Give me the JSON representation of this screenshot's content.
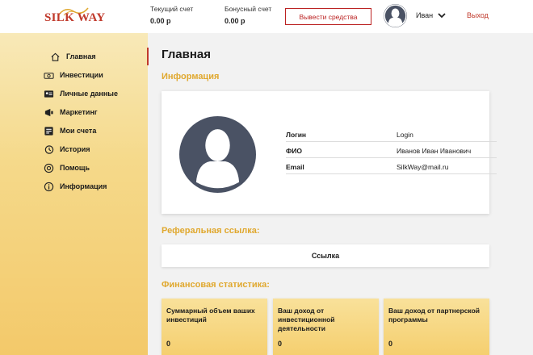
{
  "header": {
    "logo_text": "SILK WAY",
    "balance_current_label": "Текущий счет",
    "balance_current_value": "0.00 р",
    "balance_bonus_label": "Бонусный счет",
    "balance_bonus_value": "0.00 р",
    "withdraw_label": "Вывести средства",
    "user_name": "Иван",
    "logout_label": "Выход"
  },
  "sidebar": {
    "items": [
      {
        "label": "Главная",
        "icon": "home-icon",
        "active": true
      },
      {
        "label": "Инвестиции",
        "icon": "money-icon"
      },
      {
        "label": "Личные данные",
        "icon": "id-card-icon"
      },
      {
        "label": "Маркетинг",
        "icon": "marketing-icon"
      },
      {
        "label": "Мои счета",
        "icon": "accounts-icon"
      },
      {
        "label": "История",
        "icon": "history-icon"
      },
      {
        "label": "Помощь",
        "icon": "help-icon"
      },
      {
        "label": "Информация",
        "icon": "info-icon"
      }
    ]
  },
  "main": {
    "title": "Главная",
    "info_section_title": "Информация",
    "profile": [
      {
        "key": "Логин",
        "value": "Login"
      },
      {
        "key": "ФИО",
        "value": "Иванов Иван Иванович"
      },
      {
        "key": "Email",
        "value": "SilkWay@mail.ru"
      }
    ],
    "referral_title": "Реферальная ссылка:",
    "referral_value": "Ссылка",
    "finance_title": "Финансовая статистика:",
    "stats": [
      {
        "label": "Суммарный объем ваших инвестиций",
        "value": "0"
      },
      {
        "label": "Ваш доход от инвестиционной деятельности",
        "value": "0"
      },
      {
        "label": "Ваш доход от партнерской программы",
        "value": "0"
      }
    ]
  },
  "colors": {
    "accent": "#e0a82e",
    "brand_red": "#c0392b",
    "avatar": "#4a5264",
    "sidebar_top": "#f8e9b8",
    "sidebar_bottom": "#f3c96a"
  }
}
